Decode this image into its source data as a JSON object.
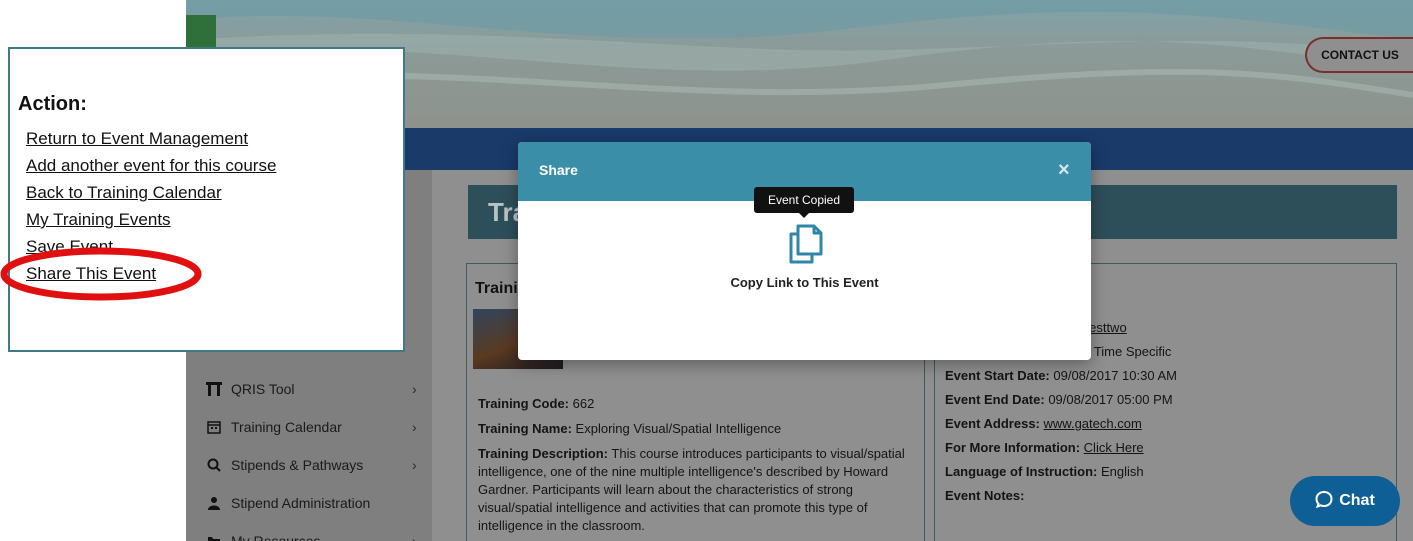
{
  "header": {
    "contact_label": "CONTACT US"
  },
  "sidebar": {
    "items": [
      {
        "label": "QRIS Tool",
        "icon": "building-icon",
        "chevron": "›"
      },
      {
        "label": "Training Calendar",
        "icon": "calendar-icon",
        "chevron": "›"
      },
      {
        "label": "Stipends & Pathways",
        "icon": "search-icon",
        "chevron": "›"
      },
      {
        "label": "Stipend Administration",
        "icon": "user-admin-icon",
        "chevron": ""
      },
      {
        "label": "My Resources",
        "icon": "folder-icon",
        "chevron": "›"
      }
    ]
  },
  "main": {
    "banner_title": "Tra",
    "left_card": {
      "heading": "Traini",
      "training_code_label": "Training Code:",
      "training_code_value": "662",
      "training_name_label": "Training Name:",
      "training_name_value": "Exploring Visual/Spatial Intelligence",
      "training_desc_label": "Training Description:",
      "training_desc_value": "This course introduces participants to visual/spatial intelligence, one of the nine multiple intelligence's described by Howard Gardner. Participants will learn about the characteristics of strong visual/spatial intelligence and activities that can promote this type of intelligence in the classroom."
    },
    "right_card": {
      "partial_line_1": "e Testtwo",
      "partial_line_2": "ed Time Specific",
      "start_label": "Event Start Date:",
      "start_value": "09/08/2017 10:30 AM",
      "end_label": "Event End Date:",
      "end_value": "09/08/2017 05:00 PM",
      "address_label": "Event Address:",
      "address_value": "www.gatech.com",
      "info_label": "For More Information:",
      "info_value": "Click Here",
      "language_label": "Language of Instruction:",
      "language_value": "English",
      "notes_label": "Event Notes:"
    }
  },
  "chat": {
    "label": "Chat"
  },
  "modal": {
    "title": "Share",
    "close_symbol": "×",
    "copy_label": "Copy Link to This Event",
    "tooltip": "Event Copied"
  },
  "action_panel": {
    "title": "Action:",
    "links": [
      "Return to Event Management",
      "Add another event for this course",
      "Back to Training Calendar",
      "My Training Events",
      "Save Event",
      "Share This Event"
    ],
    "highlight_color": "#e01010"
  }
}
